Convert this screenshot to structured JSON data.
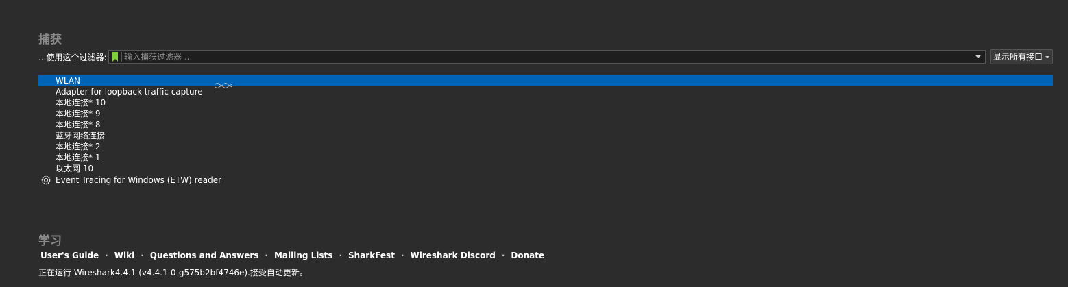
{
  "capture": {
    "title": "捕获",
    "filter_label": "...使用这个过滤器:",
    "filter_placeholder": "输入捕获过滤器 ...",
    "filter_value": "",
    "interface_view_select": "显示所有接口"
  },
  "interfaces": [
    {
      "name": "WLAN",
      "selected": true
    },
    {
      "name": "Adapter for loopback traffic capture",
      "selected": false
    },
    {
      "name": "本地连接* 10",
      "selected": false
    },
    {
      "name": "本地连接* 9",
      "selected": false
    },
    {
      "name": "本地连接* 8",
      "selected": false
    },
    {
      "name": "蓝牙网络连接",
      "selected": false
    },
    {
      "name": "本地连接* 2",
      "selected": false
    },
    {
      "name": "本地连接* 1",
      "selected": false
    },
    {
      "name": "以太网 10",
      "selected": false
    }
  ],
  "extcap_interface": {
    "name": "Event Tracing for Windows (ETW) reader",
    "icon": "gear-icon"
  },
  "learn": {
    "title": "学习",
    "links": [
      "User's Guide",
      "Wiki",
      "Questions and Answers",
      "Mailing Lists",
      "SharkFest",
      "Wireshark Discord",
      "Donate"
    ],
    "separator": "·",
    "version_text": "正在运行 Wireshark4.4.1 (v4.4.1-0-g575b2bf4746e).接受自动更新。"
  },
  "colors": {
    "background": "#2c2c2c",
    "selection": "#0063b5",
    "bookmark_green": "#7ecf3a",
    "title_gray": "#8a8a8a"
  }
}
